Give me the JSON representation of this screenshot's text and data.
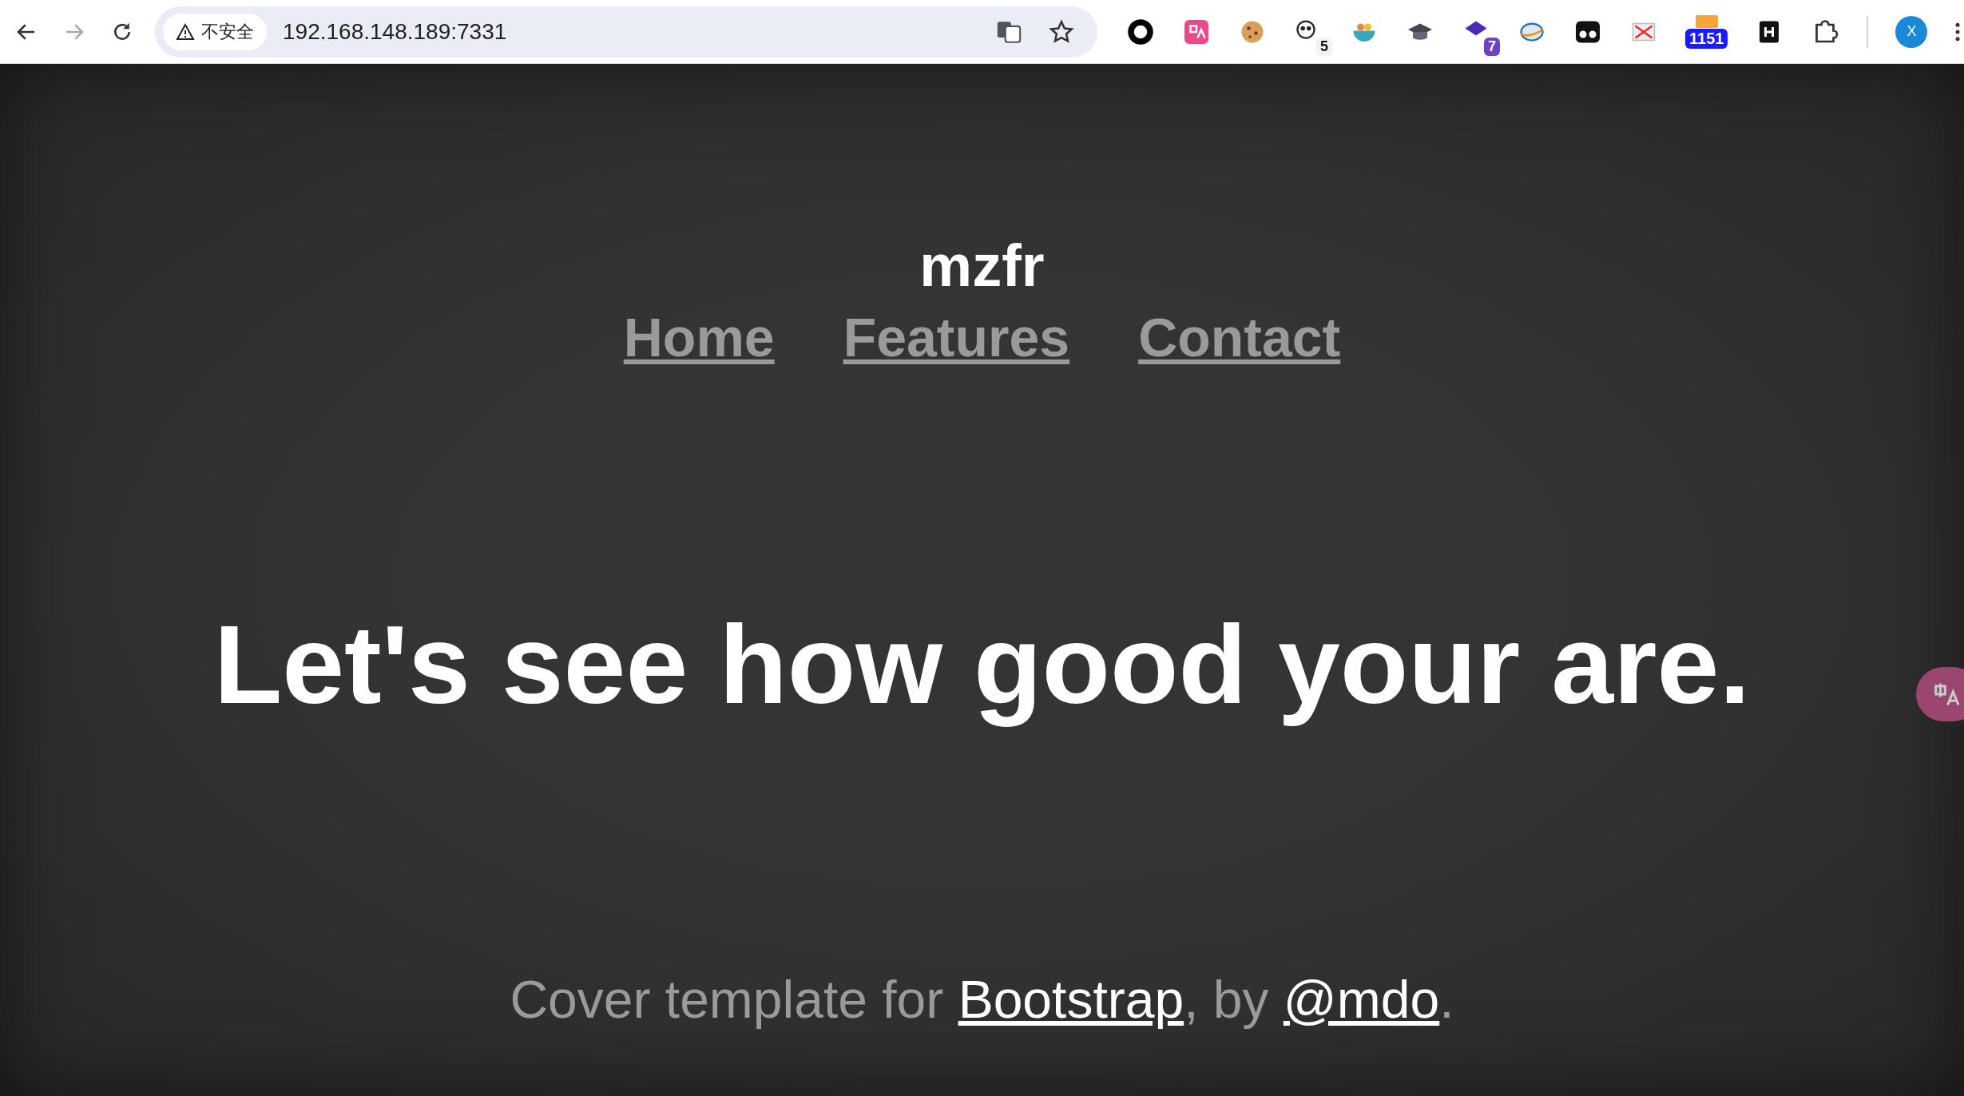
{
  "browser": {
    "security_label": "不安全",
    "url": "192.168.148.189:7331",
    "extension_badges": [
      {
        "text": "5",
        "color": "#f1f3f4"
      },
      {
        "text": "7",
        "color": "#6f42c1"
      },
      {
        "text": "1151",
        "color": "#1a1aff"
      }
    ],
    "profile_initial": "X"
  },
  "page": {
    "brand": "mzfr",
    "nav": [
      {
        "label": "Home"
      },
      {
        "label": "Features"
      },
      {
        "label": "Contact"
      }
    ],
    "headline": "Let's see how good your are.",
    "footer": [
      {
        "kind": "text",
        "text": "Cover template for "
      },
      {
        "kind": "link",
        "text": "Bootstrap"
      },
      {
        "kind": "text",
        "text": ", by "
      },
      {
        "kind": "link",
        "text": "@mdo"
      },
      {
        "kind": "text",
        "text": "."
      }
    ]
  }
}
